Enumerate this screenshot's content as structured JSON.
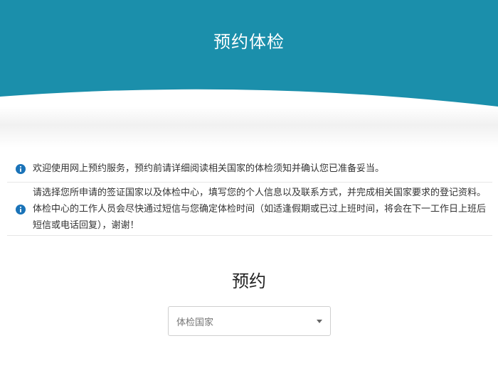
{
  "header": {
    "title": "预约体检",
    "color": "#1b8fab"
  },
  "notices": [
    {
      "icon": "info-icon",
      "text": "欢迎使用网上预约服务，预约前请详细阅读相关国家的体检须知并确认您已准备妥当。"
    },
    {
      "icon": "info-icon",
      "text": "请选择您所申请的签证国家以及体检中心，填写您的个人信息以及联系方式，并完成相关国家要求的登记资料。体检中心的工作人员会尽快通过短信与您确定体检时间（如适逢假期或已过上班时间，将会在下一工作日上班后短信或电话回复），谢谢！"
    }
  ],
  "booking": {
    "title": "预约",
    "country_select": {
      "label": "体检国家",
      "icon": "caret-down-icon"
    }
  },
  "colors": {
    "accent": "#1b8fab",
    "info_icon": "#1a73b8"
  }
}
